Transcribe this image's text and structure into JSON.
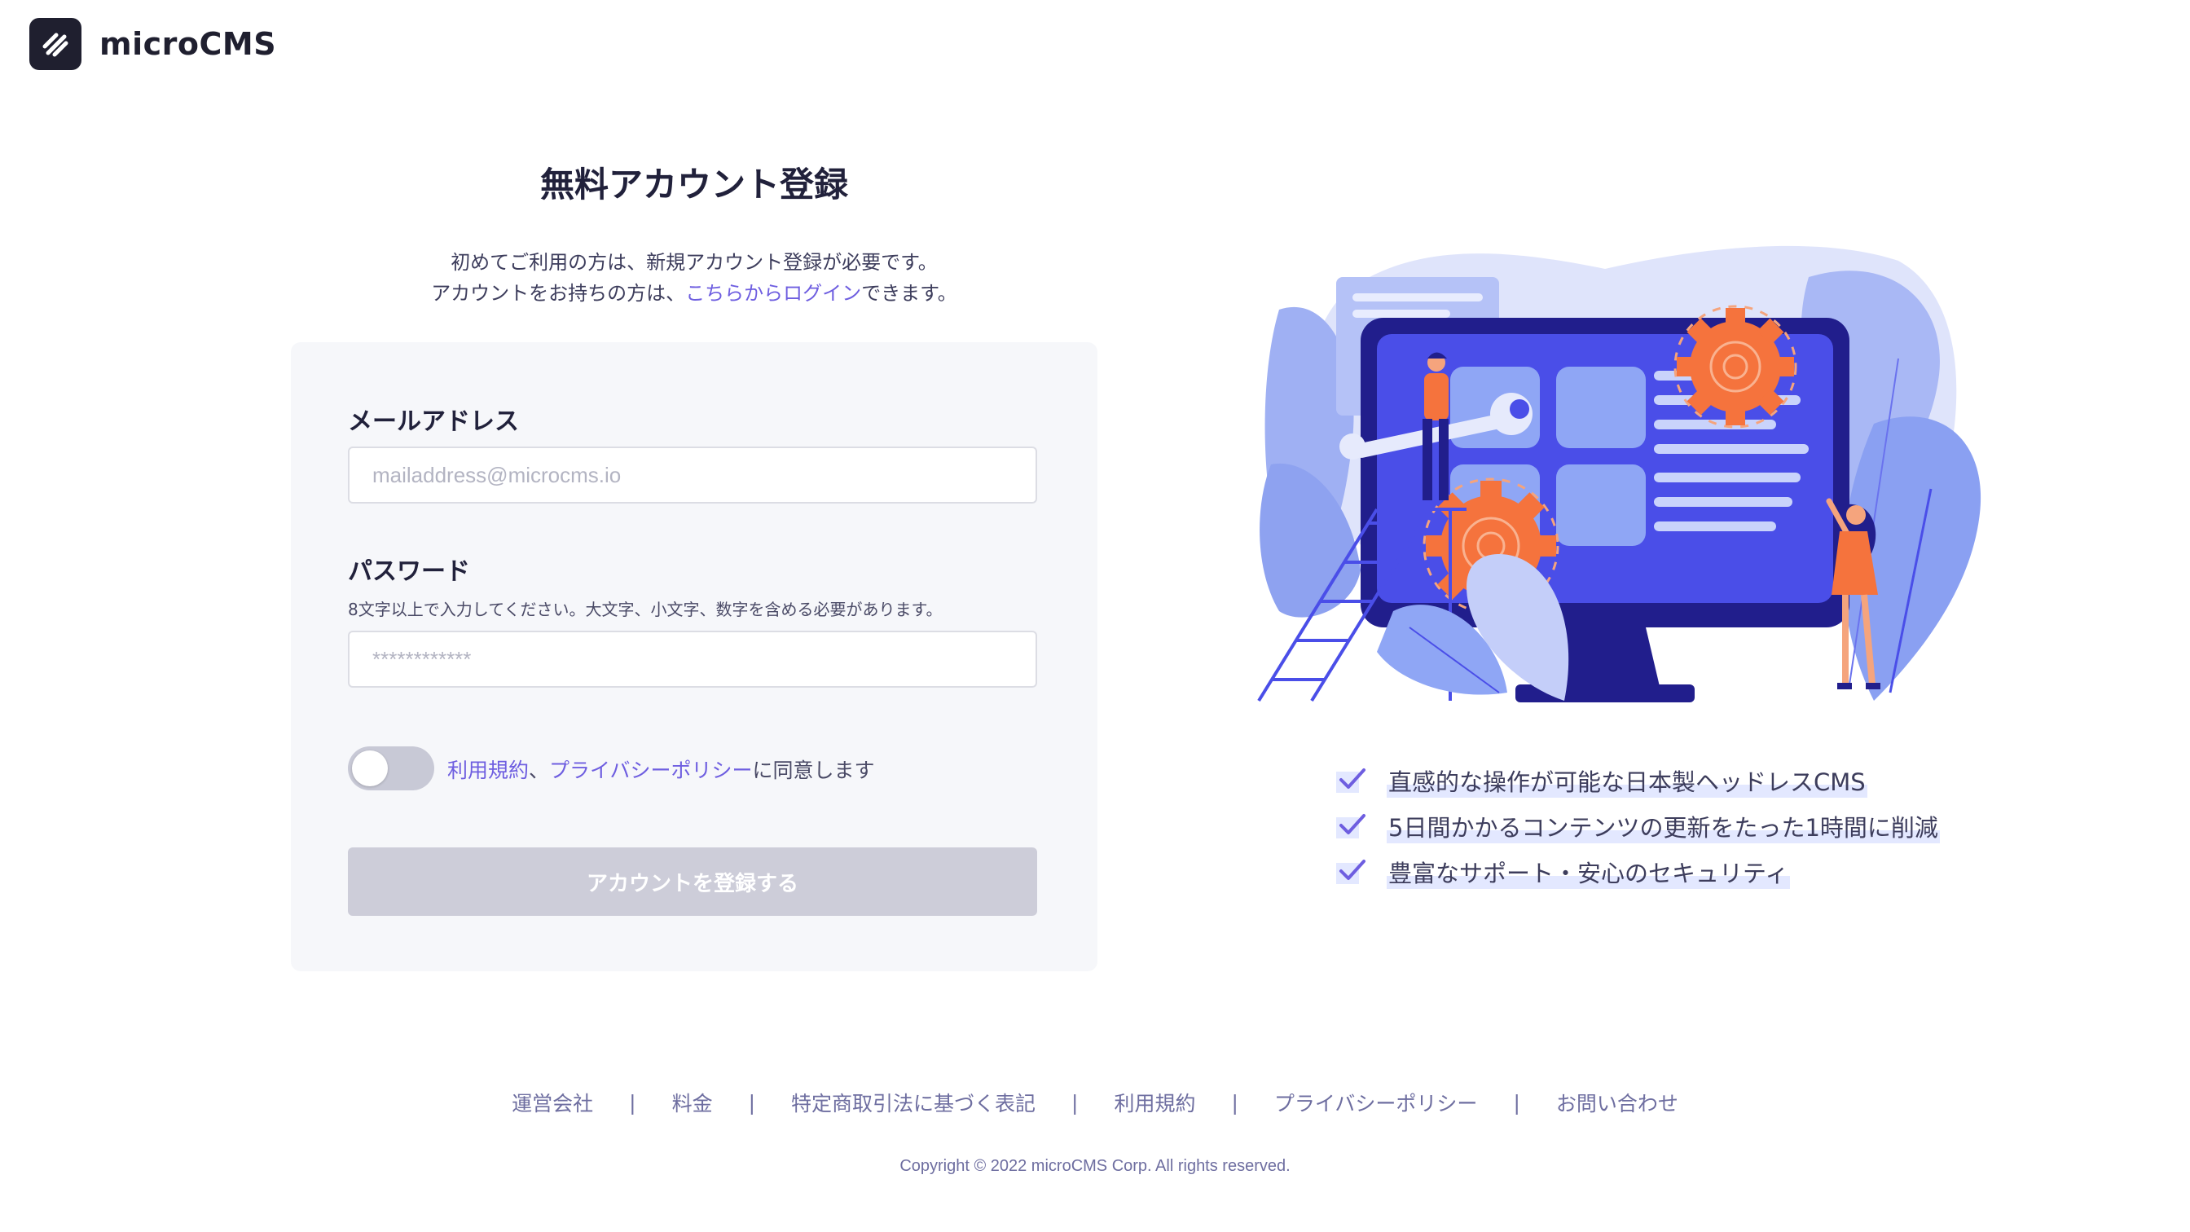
{
  "header": {
    "logo_text": "microCMS"
  },
  "signup": {
    "title": "無料アカウント登録",
    "intro_line1": "初めてご利用の方は、新規アカウント登録が必要です。",
    "intro_line2_prefix": "アカウントをお持ちの方は、",
    "intro_login_link": "こちらからログイン",
    "intro_line2_suffix": "できます。"
  },
  "form": {
    "email_label": "メールアドレス",
    "email_placeholder": "mailaddress@microcms.io",
    "email_value": "",
    "password_label": "パスワード",
    "password_hint": "8文字以上で入力してください。大文字、小文字、数字を含める必要があります。",
    "password_placeholder": "************",
    "password_value": "",
    "consent_terms_link": "利用規約",
    "consent_sep": "、",
    "consent_privacy_link": "プライバシーポリシー",
    "consent_suffix": "に同意します",
    "consent_checked": false,
    "submit_label": "アカウントを登録する"
  },
  "features": [
    {
      "text": "直感的な操作が可能な日本製ヘッドレスCMS"
    },
    {
      "text": "5日間かかるコンテンツの更新をたった1時間に削減"
    },
    {
      "text": "豊富なサポート・安心のセキュリティ"
    }
  ],
  "footer": {
    "links": [
      "運営会社",
      "料金",
      "特定商取引法に基づく表記",
      "利用規約",
      "プライバシーポリシー",
      "お問い合わせ"
    ],
    "separator": "|",
    "copyright": "Copyright © 2022 microCMS Corp. All rights reserved."
  },
  "colors": {
    "accent": "#6e5ee0",
    "illustration_primary": "#4a4ee8",
    "illustration_orange": "#f5733d",
    "illustration_light": "#d7ddfb",
    "button_disabled": "#cdcdd9"
  }
}
